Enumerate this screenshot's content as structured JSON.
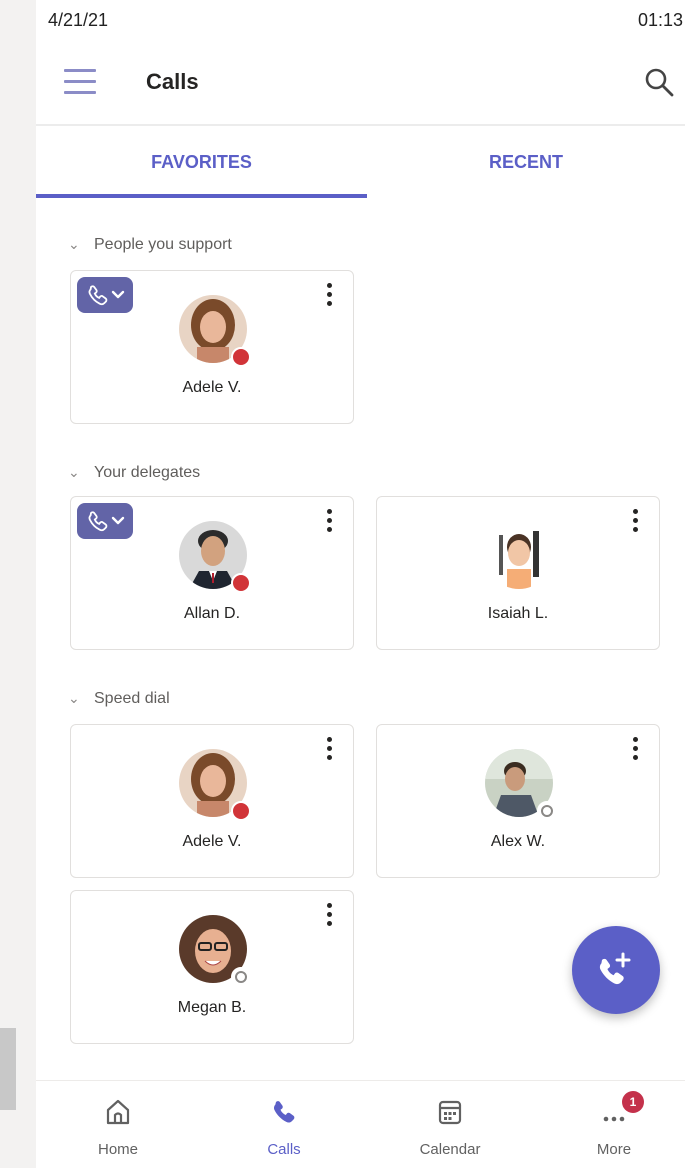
{
  "status_bar": {
    "date": "4/21/21",
    "time": "01:13"
  },
  "header": {
    "title": "Calls",
    "menu_icon": "hamburger-icon",
    "search_icon": "search-icon"
  },
  "tabs": [
    {
      "label": "FAVORITES",
      "selected": true
    },
    {
      "label": "RECENT",
      "selected": false
    }
  ],
  "sections": {
    "support": {
      "title": "People you support",
      "cards": [
        {
          "name": "Adele V.",
          "presence": "busy",
          "call_chip": true
        }
      ]
    },
    "delegates": {
      "title": "Your delegates",
      "cards": [
        {
          "name": "Allan D.",
          "presence": "busy",
          "call_chip": true
        },
        {
          "name": "Isaiah L.",
          "presence": "none",
          "call_chip": false
        }
      ]
    },
    "speed_dial": {
      "title": "Speed dial",
      "cards": [
        {
          "name": "Adele V.",
          "presence": "busy"
        },
        {
          "name": "Alex W.",
          "presence": "away"
        },
        {
          "name": "Megan B.",
          "presence": "away"
        }
      ]
    }
  },
  "fab": {
    "icon": "add-call-icon"
  },
  "bottom_nav": [
    {
      "label": "Home",
      "icon": "home-icon",
      "active": false
    },
    {
      "label": "Calls",
      "icon": "phone-icon",
      "active": true
    },
    {
      "label": "Calendar",
      "icon": "calendar-icon",
      "active": false
    },
    {
      "label": "More",
      "icon": "more-icon",
      "active": false,
      "badge": "1"
    }
  ],
  "colors": {
    "accent": "#5b5fc7",
    "busy": "#d13438",
    "badge": "#c4314b",
    "chip": "#6264a7"
  }
}
